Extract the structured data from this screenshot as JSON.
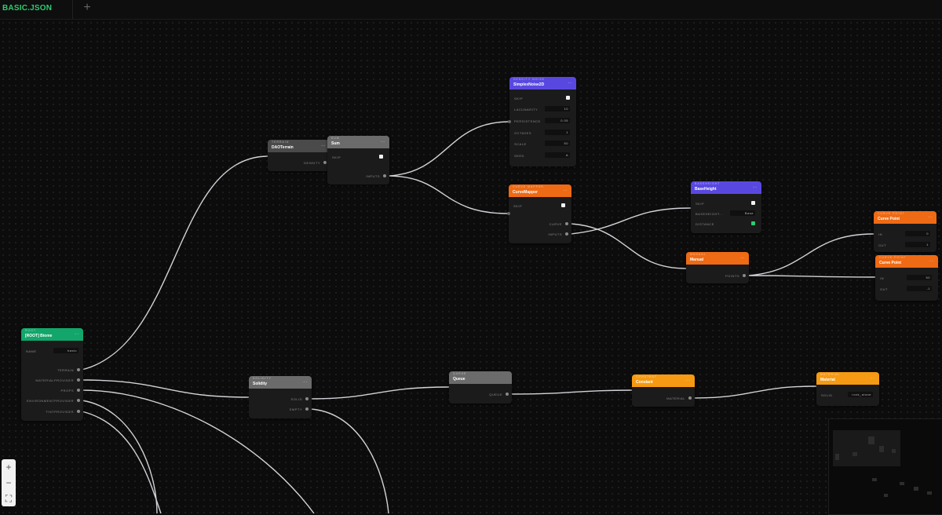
{
  "tabs": [
    {
      "label": "BASIC.JSON"
    }
  ],
  "add_tab_label": "+",
  "zoom": {
    "in": "+",
    "out": "−",
    "fit": "⛶"
  },
  "colors": {
    "green": "#12a66b",
    "blue": "#5948e0",
    "orange": "#ee6a14",
    "amber": "#f59a12",
    "gray": "#6b6b6b",
    "wire": "#e8e8ee"
  },
  "nodes": {
    "root": {
      "type": "ROOT",
      "title": "[ROOT] Biome",
      "name_label": "NAME",
      "name_value": "basic",
      "outputs": [
        "TERRAIN",
        "MATERIALPROVIDER",
        "PROPS",
        "ENVIRONMENTPROVIDER",
        "TINTPROVIDER"
      ]
    },
    "dao": {
      "type": "TERRAIN",
      "title": "DAOTerrain",
      "outputs": [
        "DENSITY"
      ]
    },
    "sum": {
      "type": "SUM",
      "title": "Sum",
      "skip": "SKIP",
      "outputs": [
        "INPUTS"
      ]
    },
    "simplex": {
      "type": "DENSITY NOISE",
      "title": "SimplexNoise2D",
      "rows": [
        {
          "label": "SKIP",
          "kind": "check"
        },
        {
          "label": "LACUNARITY",
          "value": "10"
        },
        {
          "label": "PERSISTENCE",
          "value": "0.05"
        },
        {
          "label": "OCTAVES",
          "value": "1"
        },
        {
          "label": "SCALE",
          "value": "50"
        },
        {
          "label": "SEED",
          "value": "A"
        }
      ]
    },
    "curvemapper": {
      "type": "CURVE MAPPER",
      "title": "CurveMapper",
      "skip": "SKIP",
      "outputs": [
        "CURVE",
        "INPUTS"
      ]
    },
    "baseheight": {
      "type": "BASEHEIGHT",
      "title": "BaseHeight",
      "skip": "SKIP",
      "baseheight_label": "BASEHEIGHT...",
      "baseheight_value": "Base",
      "distance_label": "DISTANCE"
    },
    "manual": {
      "type": "MANUAL",
      "title": "Manual",
      "outputs": [
        "POINTS"
      ]
    },
    "curvepoint1": {
      "type": "CURVE POINT",
      "title": "Curve Point",
      "in_label": "IN",
      "in_value": "0",
      "out_label": "OUT",
      "out_value": "1"
    },
    "curvepoint2": {
      "type": "CURVE POINT",
      "title": "Curve Point",
      "in_label": "IN",
      "in_value": "50",
      "out_label": "OUT",
      "out_value": "-1"
    },
    "solidity": {
      "type": "SOLIDITY",
      "title": "Solidity",
      "outputs": [
        "SOLID",
        "EMPTY"
      ]
    },
    "queue": {
      "type": "QUEUE",
      "title": "Queue",
      "outputs": [
        "QUEUE"
      ]
    },
    "constant": {
      "type": "CONSTANT",
      "title": "Constant",
      "outputs": [
        "MATERIAL"
      ]
    },
    "material": {
      "type": "MATERIAL",
      "title": "Material",
      "solid_label": "SOLID",
      "solid_value": "rock_stone"
    }
  }
}
